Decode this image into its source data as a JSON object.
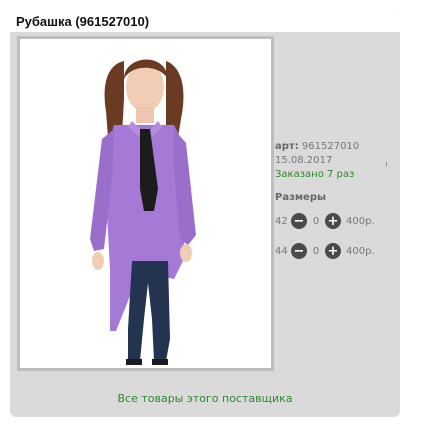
{
  "product": {
    "title": "Рубашка (961527010)",
    "art_label": "арт:",
    "art_value": "961527010",
    "date": "15.08.2017",
    "ordered_text": "Заказано 7 раз"
  },
  "sizes": {
    "title": "Размеры",
    "rows": [
      {
        "size": "42",
        "minus_icon": "minus-circle-icon",
        "qty": "0",
        "plus_icon": "plus-circle-icon",
        "price": "400р."
      },
      {
        "size": "44",
        "minus_icon": "minus-circle-icon",
        "qty": "0",
        "plus_icon": "plus-circle-icon",
        "price": "400р."
      }
    ]
  },
  "footer": {
    "supplier_link": "Все товары этого поставщика"
  },
  "colors": {
    "card_bg": "#dadada",
    "accent_green": "#2d8a2d",
    "button_dark": "#4a4a4a",
    "shirt": "#a57ad6",
    "tie": "#1c1c1c",
    "jeans": "#243350"
  }
}
